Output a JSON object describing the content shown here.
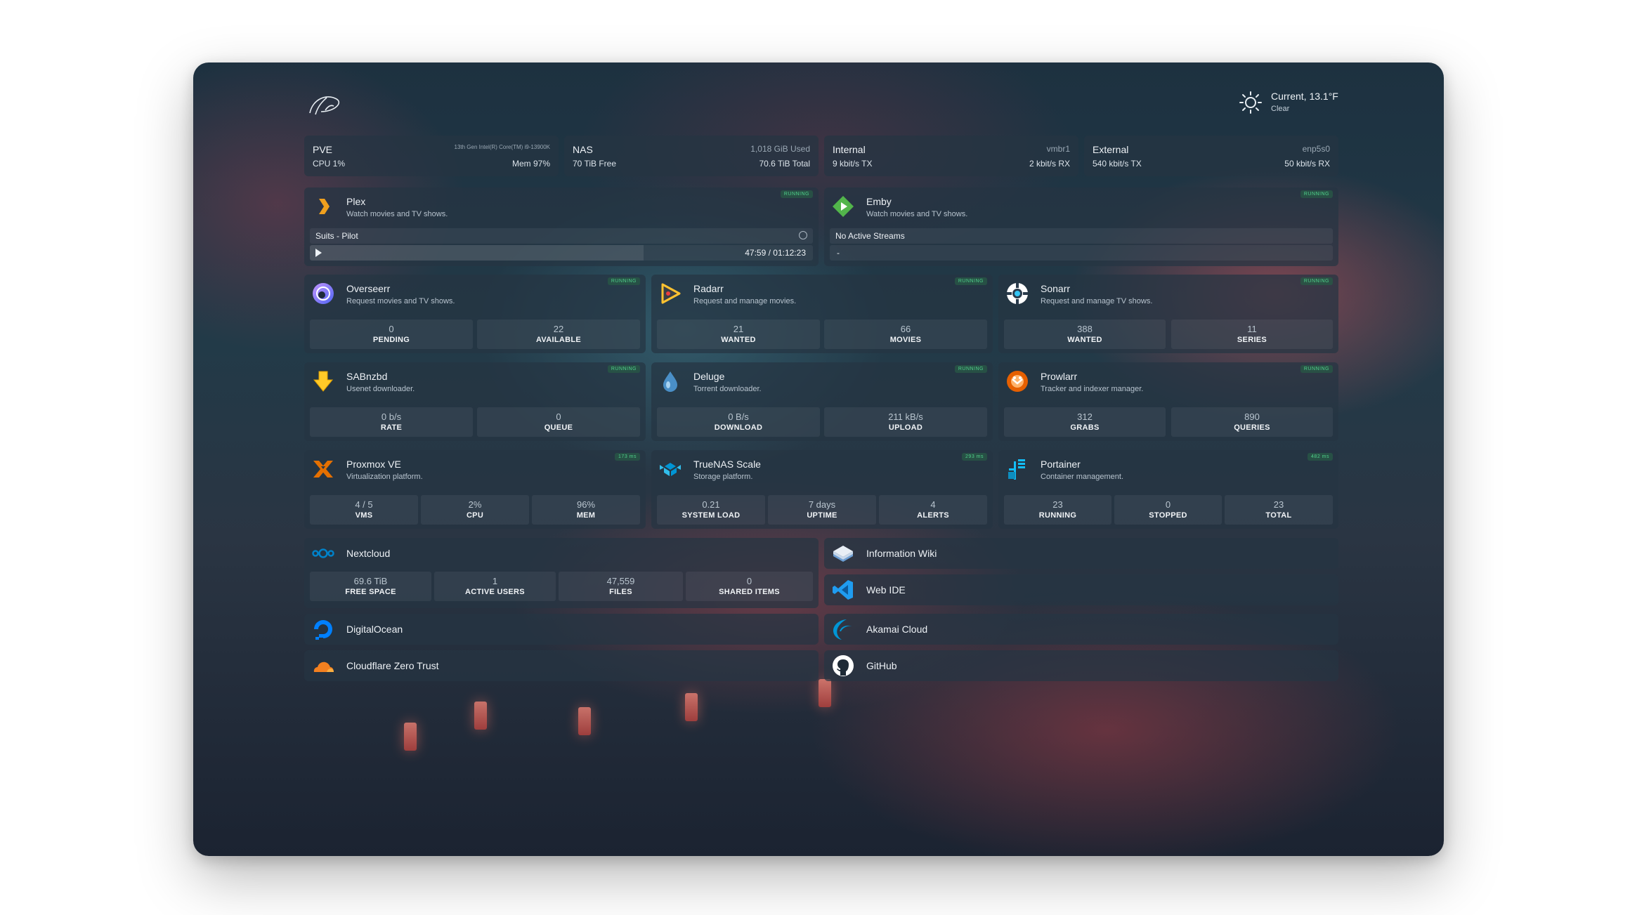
{
  "weather": {
    "label": "Current, 13.1°F",
    "condition": "Clear"
  },
  "resources": [
    {
      "name": "PVE",
      "detail": "13th Gen Intel(R) Core(TM) i9-13900K",
      "left": "CPU 1%",
      "right": "Mem 97%"
    },
    {
      "name": "NAS",
      "detail": "1,018 GiB Used",
      "left": "70 TiB Free",
      "right": "70.6 TiB Total"
    },
    {
      "name": "Internal",
      "detail": "vmbr1",
      "left": "9 kbit/s TX",
      "right": "2 kbit/s RX"
    },
    {
      "name": "External",
      "detail": "enp5s0",
      "left": "540 kbit/s TX",
      "right": "50 kbit/s RX"
    }
  ],
  "status_running": "RUNNING",
  "plex": {
    "name": "Plex",
    "desc": "Watch movies and TV shows.",
    "stream": "Suits - Pilot",
    "time": "47:59 / 01:12:23",
    "progress": 0.663
  },
  "emby": {
    "name": "Emby",
    "desc": "Watch movies and TV shows.",
    "stream": "No Active Streams",
    "time": "-"
  },
  "services": [
    {
      "name": "Overseerr",
      "desc": "Request movies and TV shows.",
      "stats": [
        {
          "v": "0",
          "l": "PENDING"
        },
        {
          "v": "22",
          "l": "AVAILABLE"
        }
      ]
    },
    {
      "name": "Radarr",
      "desc": "Request and manage movies.",
      "stats": [
        {
          "v": "21",
          "l": "WANTED"
        },
        {
          "v": "66",
          "l": "MOVIES"
        }
      ]
    },
    {
      "name": "Sonarr",
      "desc": "Request and manage TV shows.",
      "stats": [
        {
          "v": "388",
          "l": "WANTED"
        },
        {
          "v": "11",
          "l": "SERIES"
        }
      ]
    },
    {
      "name": "SABnzbd",
      "desc": "Usenet downloader.",
      "stats": [
        {
          "v": "0 b/s",
          "l": "RATE"
        },
        {
          "v": "0",
          "l": "QUEUE"
        }
      ]
    },
    {
      "name": "Deluge",
      "desc": "Torrent downloader.",
      "stats": [
        {
          "v": "0 B/s",
          "l": "DOWNLOAD"
        },
        {
          "v": "211 kB/s",
          "l": "UPLOAD"
        }
      ]
    },
    {
      "name": "Prowlarr",
      "desc": "Tracker and indexer manager.",
      "stats": [
        {
          "v": "312",
          "l": "GRABS"
        },
        {
          "v": "890",
          "l": "QUERIES"
        }
      ]
    }
  ],
  "infra": [
    {
      "name": "Proxmox VE",
      "desc": "Virtualization platform.",
      "badge": "173 ms",
      "stats": [
        {
          "v": "4 / 5",
          "l": "VMS"
        },
        {
          "v": "2%",
          "l": "CPU"
        },
        {
          "v": "96%",
          "l": "MEM"
        }
      ]
    },
    {
      "name": "TrueNAS Scale",
      "desc": "Storage platform.",
      "badge": "293 ms",
      "stats": [
        {
          "v": "0.21",
          "l": "SYSTEM LOAD"
        },
        {
          "v": "7 days",
          "l": "UPTIME"
        },
        {
          "v": "4",
          "l": "ALERTS"
        }
      ]
    },
    {
      "name": "Portainer",
      "desc": "Container management.",
      "badge": "482 ms",
      "stats": [
        {
          "v": "23",
          "l": "RUNNING"
        },
        {
          "v": "0",
          "l": "STOPPED"
        },
        {
          "v": "23",
          "l": "TOTAL"
        }
      ]
    }
  ],
  "nextcloud": {
    "name": "Nextcloud",
    "stats": [
      {
        "v": "69.6 TiB",
        "l": "FREE SPACE"
      },
      {
        "v": "1",
        "l": "ACTIVE USERS"
      },
      {
        "v": "47,559",
        "l": "FILES"
      },
      {
        "v": "0",
        "l": "SHARED ITEMS"
      }
    ]
  },
  "links": {
    "wiki": "Information Wiki",
    "webide": "Web IDE",
    "digitalocean": "DigitalOcean",
    "akamai": "Akamai Cloud",
    "cloudflare": "Cloudflare Zero Trust",
    "github": "GitHub"
  }
}
